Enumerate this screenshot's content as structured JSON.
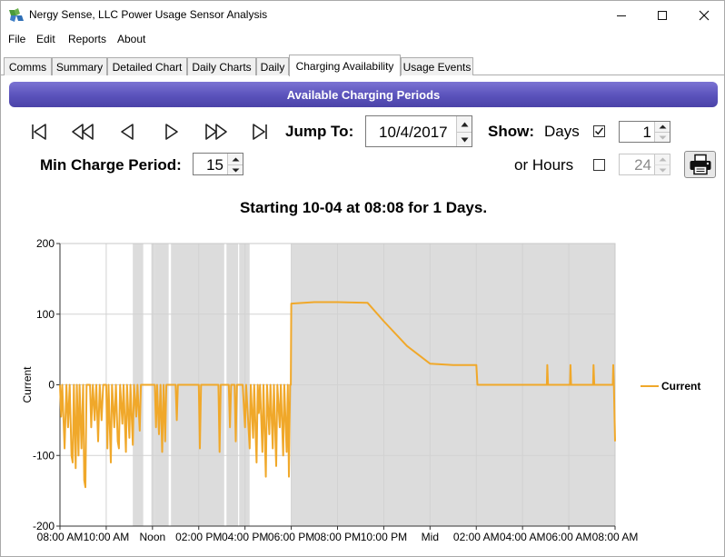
{
  "window": {
    "title": "Nergy Sense, LLC Power Usage Sensor Analysis"
  },
  "menu": [
    "File",
    "Edit",
    "Reports",
    "About"
  ],
  "tabs": [
    "Comms",
    "Summary",
    "Detailed Chart",
    "Daily Charts",
    "Daily",
    "Charging Availability",
    "Usage Events"
  ],
  "active_tab": "Charging Availability",
  "panel": {
    "header": "Available Charging Periods"
  },
  "controls": {
    "jump_to_label": "Jump To:",
    "date_value": "10/4/2017",
    "show_label": "Show:",
    "days_label": "Days",
    "days_checked": true,
    "days_value": "1",
    "hours_label": "or Hours",
    "hours_checked": false,
    "hours_value": "24",
    "min_charge_label": "Min Charge Period:",
    "min_charge_value": "15"
  },
  "chart_data": {
    "type": "line",
    "title": "Starting 10-04 at 08:08 for 1 Days.",
    "xlabel": "",
    "ylabel": "Current",
    "ylim": [
      -200,
      200
    ],
    "yticks": [
      -200,
      -100,
      0,
      100,
      200
    ],
    "xlim": [
      8,
      32
    ],
    "x_tick_values": [
      8,
      10,
      12,
      14,
      16,
      18,
      20,
      22,
      24,
      26,
      28,
      30,
      32
    ],
    "x_tick_labels": [
      "08:00 AM",
      "10:00 AM",
      "Noon",
      "02:00 PM",
      "04:00 PM",
      "06:00 PM",
      "08:00 PM",
      "10:00 PM",
      "Mid",
      "02:00 AM",
      "04:00 AM",
      "06:00 AM",
      "08:00 AM"
    ],
    "legend": {
      "position": "right"
    },
    "series": [
      {
        "name": "Current",
        "color": "#f0a82a",
        "points": [
          [
            8.0,
            0
          ],
          [
            8.05,
            -45
          ],
          [
            8.1,
            0
          ],
          [
            8.2,
            -90
          ],
          [
            8.28,
            0
          ],
          [
            8.35,
            -60
          ],
          [
            8.42,
            0
          ],
          [
            8.5,
            -100
          ],
          [
            8.55,
            -110
          ],
          [
            8.6,
            0
          ],
          [
            8.68,
            -118
          ],
          [
            8.73,
            0
          ],
          [
            8.8,
            -100
          ],
          [
            8.85,
            0
          ],
          [
            8.93,
            -90
          ],
          [
            9.0,
            0
          ],
          [
            9.05,
            -135
          ],
          [
            9.1,
            -145
          ],
          [
            9.15,
            0
          ],
          [
            9.3,
            0
          ],
          [
            9.35,
            -60
          ],
          [
            9.42,
            0
          ],
          [
            9.5,
            -50
          ],
          [
            9.57,
            0
          ],
          [
            9.65,
            -80
          ],
          [
            9.72,
            0
          ],
          [
            9.8,
            -50
          ],
          [
            9.87,
            0
          ],
          [
            10.0,
            0
          ],
          [
            10.05,
            -90
          ],
          [
            10.1,
            0
          ],
          [
            10.2,
            -110
          ],
          [
            10.25,
            0
          ],
          [
            10.35,
            -60
          ],
          [
            10.42,
            0
          ],
          [
            10.5,
            -80
          ],
          [
            10.55,
            -90
          ],
          [
            10.6,
            0
          ],
          [
            10.7,
            -55
          ],
          [
            10.75,
            0
          ],
          [
            10.85,
            -95
          ],
          [
            10.9,
            0
          ],
          [
            11.0,
            -75
          ],
          [
            11.05,
            0
          ],
          [
            11.15,
            -85
          ],
          [
            11.2,
            0
          ],
          [
            11.3,
            -45
          ],
          [
            11.35,
            0
          ],
          [
            11.45,
            -65
          ],
          [
            11.5,
            0
          ],
          [
            11.7,
            0
          ],
          [
            12.1,
            0
          ],
          [
            12.15,
            -60
          ],
          [
            12.2,
            0
          ],
          [
            12.28,
            -70
          ],
          [
            12.35,
            0
          ],
          [
            12.42,
            -95
          ],
          [
            12.48,
            0
          ],
          [
            12.55,
            -80
          ],
          [
            12.6,
            0
          ],
          [
            12.7,
            0
          ],
          [
            13.0,
            0
          ],
          [
            13.05,
            -50
          ],
          [
            13.1,
            0
          ],
          [
            13.2,
            0
          ],
          [
            14.0,
            0
          ],
          [
            14.05,
            -90
          ],
          [
            14.1,
            0
          ],
          [
            14.5,
            0
          ],
          [
            14.6,
            0
          ],
          [
            14.85,
            0
          ],
          [
            14.9,
            -95
          ],
          [
            14.95,
            0
          ],
          [
            15.1,
            0
          ],
          [
            15.3,
            0
          ],
          [
            15.35,
            -60
          ],
          [
            15.4,
            0
          ],
          [
            15.55,
            0
          ],
          [
            15.6,
            -80
          ],
          [
            15.65,
            0
          ],
          [
            15.9,
            0
          ],
          [
            16.0,
            -60
          ],
          [
            16.05,
            0
          ],
          [
            16.2,
            -90
          ],
          [
            16.25,
            0
          ],
          [
            16.35,
            -75
          ],
          [
            16.4,
            0
          ],
          [
            16.5,
            -110
          ],
          [
            16.55,
            0
          ],
          [
            16.6,
            -40
          ],
          [
            16.65,
            0
          ],
          [
            16.75,
            -95
          ],
          [
            16.8,
            0
          ],
          [
            16.9,
            -130
          ],
          [
            16.95,
            0
          ],
          [
            17.05,
            -70
          ],
          [
            17.1,
            0
          ],
          [
            17.2,
            -90
          ],
          [
            17.25,
            0
          ],
          [
            17.35,
            -115
          ],
          [
            17.4,
            0
          ],
          [
            17.5,
            -60
          ],
          [
            17.55,
            0
          ],
          [
            17.65,
            -100
          ],
          [
            17.7,
            0
          ],
          [
            17.8,
            -95
          ],
          [
            17.85,
            0
          ],
          [
            17.9,
            -130
          ],
          [
            17.95,
            0
          ],
          [
            17.98,
            0
          ],
          [
            18.0,
            115
          ],
          [
            19.0,
            117
          ],
          [
            20.0,
            117
          ],
          [
            21.3,
            116
          ],
          [
            22.0,
            90
          ],
          [
            23.0,
            55
          ],
          [
            24.0,
            30
          ],
          [
            25.0,
            28
          ],
          [
            26.0,
            28
          ],
          [
            26.05,
            0
          ],
          [
            28.0,
            0
          ],
          [
            29.05,
            0
          ],
          [
            29.07,
            28
          ],
          [
            29.1,
            0
          ],
          [
            30.05,
            0
          ],
          [
            30.07,
            28
          ],
          [
            30.1,
            0
          ],
          [
            31.05,
            0
          ],
          [
            31.07,
            28
          ],
          [
            31.1,
            0
          ],
          [
            31.9,
            0
          ],
          [
            31.92,
            28
          ],
          [
            31.95,
            0
          ],
          [
            32.0,
            -80
          ]
        ]
      }
    ],
    "shaded_regions": [
      [
        11.15,
        11.6
      ],
      [
        11.95,
        12.1
      ],
      [
        12.1,
        12.7
      ],
      [
        12.8,
        15.1
      ],
      [
        15.2,
        15.7
      ],
      [
        15.75,
        16.2
      ],
      [
        18.0,
        32.0
      ]
    ]
  }
}
